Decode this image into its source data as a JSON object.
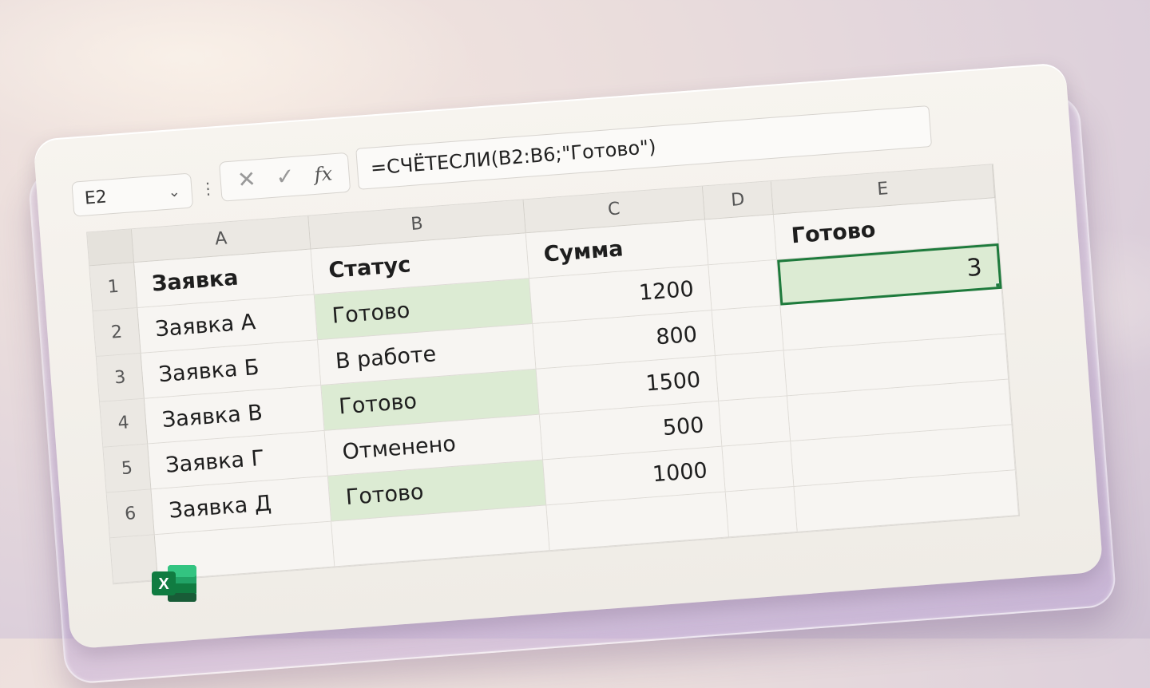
{
  "colors": {
    "accent_green": "#1e7a3c",
    "highlight_fill": "#dcebd3",
    "excel_brand": "#107c41"
  },
  "formula_bar": {
    "name_box": "E2",
    "name_box_icon": "chevron-down-icon",
    "menu_icon": "vertical-dots-icon",
    "cancel_icon": "close-icon",
    "enter_icon": "check-icon",
    "fx_label": "fx",
    "formula": "=СЧЁТЕСЛИ(B2:B6;\"Готово\")"
  },
  "columns": [
    "A",
    "B",
    "C",
    "D",
    "E"
  ],
  "row_numbers": [
    "1",
    "2",
    "3",
    "4",
    "5",
    "6"
  ],
  "rows": [
    {
      "A": "Заявка",
      "B": "Статус",
      "C": "Сумма",
      "D": "",
      "E": "Готово"
    },
    {
      "A": "Заявка А",
      "B": "Готово",
      "C": "1200",
      "D": "",
      "E": "3"
    },
    {
      "A": "Заявка Б",
      "B": "В работе",
      "C": "800",
      "D": "",
      "E": ""
    },
    {
      "A": "Заявка В",
      "B": "Готово",
      "C": "1500",
      "D": "",
      "E": ""
    },
    {
      "A": "Заявка Г",
      "B": "Отменено",
      "C": "500",
      "D": "",
      "E": ""
    },
    {
      "A": "Заявка Д",
      "B": "Готово",
      "C": "1000",
      "D": "",
      "E": ""
    }
  ],
  "selected_cell": "E2",
  "app_logo": {
    "icon": "excel-logo-icon",
    "letter": "X"
  }
}
